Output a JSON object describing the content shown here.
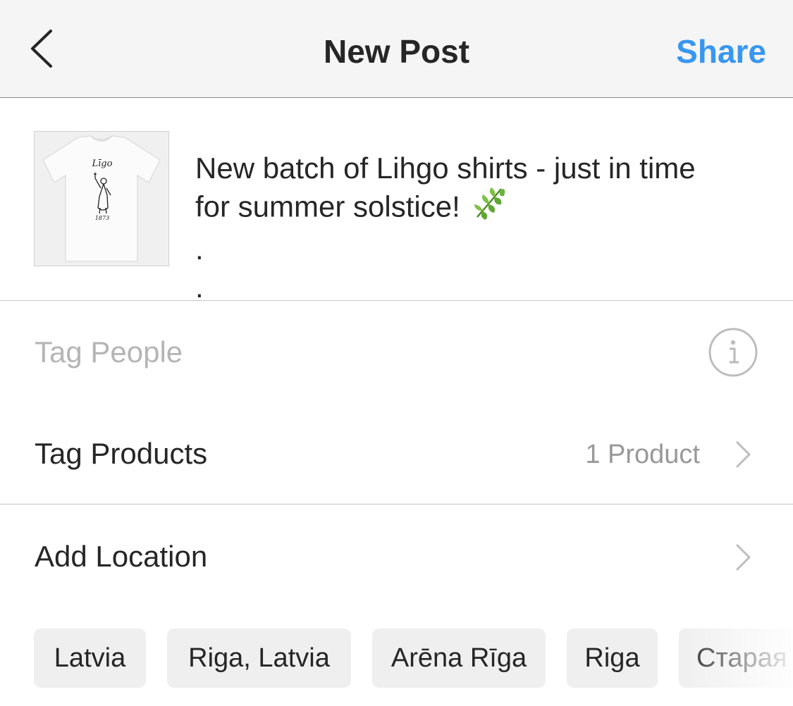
{
  "header": {
    "title": "New Post",
    "share_label": "Share",
    "accent_color": "#3897f0"
  },
  "composer": {
    "thumbnail": {
      "shirt_script_text": "Līgo",
      "shirt_year_text": "1873"
    },
    "caption_lines": [
      "New batch of Lihgo shirts - just in time",
      "for summer solstice!",
      ".",
      "."
    ],
    "caption_emoji_icon": "herb-leaf-icon"
  },
  "options": {
    "tag_people": {
      "label": "Tag People",
      "icon": "info-icon"
    },
    "tag_products": {
      "label": "Tag Products",
      "value": "1 Product",
      "icon": "chevron-right-icon"
    },
    "add_location": {
      "label": "Add Location",
      "icon": "chevron-right-icon"
    }
  },
  "location_suggestions": [
    "Latvia",
    "Riga, Latvia",
    "Arēna Rīga",
    "Riga",
    "Старая"
  ]
}
